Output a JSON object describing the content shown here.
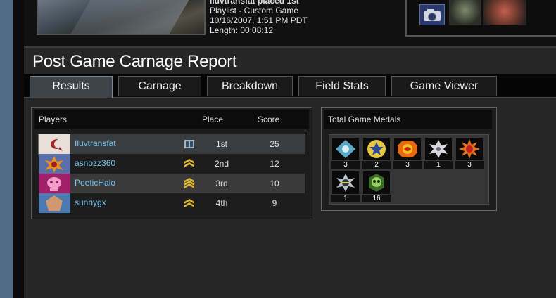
{
  "game": {
    "line1": "iluvtransfat placed 1st",
    "playlist": "Playlist - Custom Game",
    "date": "10/16/2007, 1:51 PM PDT",
    "length": "Length: 00:08:12"
  },
  "media": {
    "icon": "camera-icon"
  },
  "report": {
    "title": "Post Game Carnage Report"
  },
  "tabs": [
    {
      "label": "Results",
      "active": true
    },
    {
      "label": "Carnage"
    },
    {
      "label": "Breakdown"
    },
    {
      "label": "Field Stats"
    },
    {
      "label": "Game Viewer"
    }
  ],
  "players_panel": {
    "headers": {
      "players": "Players",
      "place": "Place",
      "score": "Score"
    },
    "rows": [
      {
        "name": "Iluvtransfat",
        "place": "1st",
        "score": "25",
        "emblem_color": "#e8e0d8",
        "rank_icon": "rank-icon"
      },
      {
        "name": "asnozz360",
        "place": "2nd",
        "score": "12",
        "emblem_color": "#5a6ea8",
        "rank_icon": "rank-chevron-icon"
      },
      {
        "name": "PoeticHalo",
        "place": "3rd",
        "score": "10",
        "emblem_color": "#a0206a",
        "rank_icon": "rank-chevron-icon"
      },
      {
        "name": "sunnygx",
        "place": "4th",
        "score": "9",
        "emblem_color": "#4a7ab0",
        "rank_icon": "rank-chevron-icon"
      }
    ]
  },
  "medals_panel": {
    "title": "Total Game Medals",
    "medals": [
      {
        "icon": "diamond-medal-icon",
        "count": "3"
      },
      {
        "icon": "star-medal-icon",
        "count": "2"
      },
      {
        "icon": "orange-medal-icon",
        "count": "3"
      },
      {
        "icon": "white-star-medal-icon",
        "count": "1"
      },
      {
        "icon": "burst-medal-icon",
        "count": "3"
      },
      {
        "icon": "sun-medal-icon",
        "count": "1"
      },
      {
        "icon": "skull-medal-icon",
        "count": "16"
      }
    ]
  }
}
